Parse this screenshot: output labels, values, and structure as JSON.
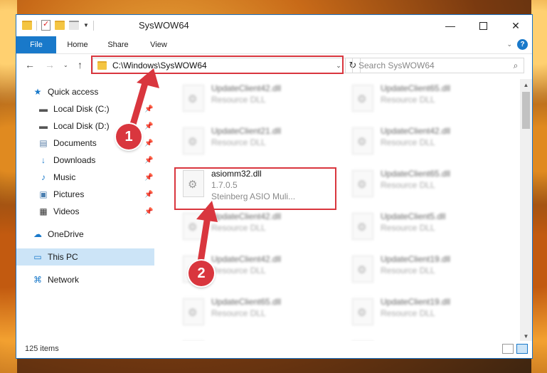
{
  "window": {
    "title": "SysWOW64",
    "minimize": "—",
    "maximize": "",
    "close": "✕"
  },
  "ribbon": {
    "tabs": [
      "File",
      "Home",
      "Share",
      "View"
    ],
    "expand": "⌄",
    "help": "?"
  },
  "address": {
    "path": "C:\\Windows\\SysWOW64",
    "dropdown": "⌄",
    "refresh": "↻"
  },
  "search": {
    "placeholder": "Search SysWOW64",
    "icon": "⌕"
  },
  "nav": {
    "back": "←",
    "forward": "→",
    "recent": "⌄",
    "up": "↑"
  },
  "sidebar": {
    "items": [
      {
        "label": "Quick access",
        "icon": "★"
      },
      {
        "label": "Local Disk (C:)",
        "icon": "▬"
      },
      {
        "label": "Local Disk (D:)",
        "icon": "▬"
      },
      {
        "label": "Documents",
        "icon": "▤"
      },
      {
        "label": "Downloads",
        "icon": "↓"
      },
      {
        "label": "Music",
        "icon": "♪"
      },
      {
        "label": "Pictures",
        "icon": "▣"
      },
      {
        "label": "Videos",
        "icon": "▦"
      },
      {
        "label": "OneDrive",
        "icon": "☁"
      },
      {
        "label": "This PC",
        "icon": "▭"
      },
      {
        "label": "Network",
        "icon": "⌘"
      }
    ],
    "pin": "📌"
  },
  "files": {
    "left": [
      {
        "name": "UpdateClient42.dll",
        "type": "Resource DLL"
      },
      {
        "name": "UpdateClient21.dll",
        "type": "Resource DLL"
      },
      {
        "name": "asiomm32.dll",
        "type": "1.7.0.5",
        "desc": "Steinberg ASIO Muli..."
      },
      {
        "name": "UpdateClient42.dll",
        "type": "Resource DLL"
      },
      {
        "name": "UpdateClient42.dll",
        "type": "Resource DLL"
      },
      {
        "name": "UpdateClient65.dll",
        "type": "Resource DLL"
      },
      {
        "name": "",
        "type": ""
      }
    ],
    "right": [
      {
        "name": "UpdateClient65.dll",
        "type": "Resource DLL"
      },
      {
        "name": "UpdateClient42.dll",
        "type": "Resource DLL"
      },
      {
        "name": "UpdateClient65.dll",
        "type": "Resource DLL"
      },
      {
        "name": "UpdateClient5.dll",
        "type": "Resource DLL"
      },
      {
        "name": "UpdateClient19.dll",
        "type": "Resource DLL"
      },
      {
        "name": "UpdateClient19.dll",
        "type": "Resource DLL"
      },
      {
        "name": "",
        "type": ""
      }
    ]
  },
  "status": {
    "count": "125 items"
  },
  "callouts": [
    "1",
    "2"
  ],
  "colors": {
    "accent": "#1979ca",
    "highlight": "#d9363e",
    "selected": "#cce4f7"
  }
}
